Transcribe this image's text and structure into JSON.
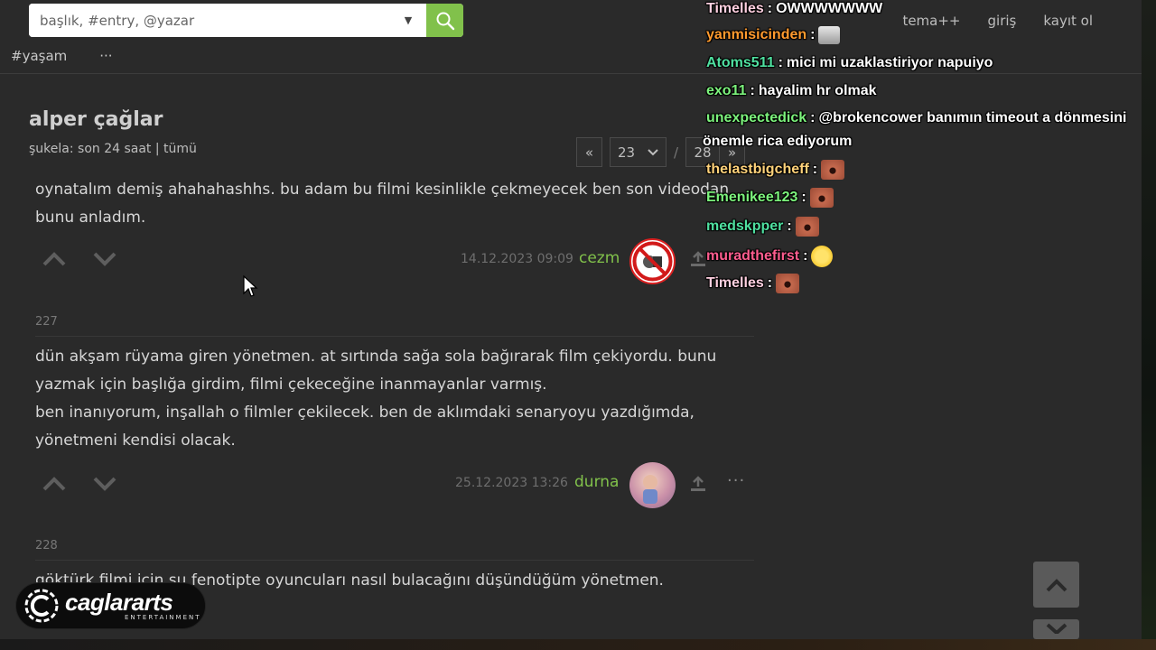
{
  "search": {
    "placeholder": "başlık, #entry, @yazar"
  },
  "top_nav": [
    "tema++",
    "giriş",
    "kayıt ol"
  ],
  "sub_nav": {
    "channel": "#yaşam",
    "more": "···"
  },
  "topic": {
    "title": "alper çağlar",
    "sukela_prefix": "şukela:",
    "sukela_links": [
      "son 24 saat",
      "tümü"
    ],
    "sep": "|"
  },
  "pager": {
    "prev": "«",
    "current": "23",
    "slash": "/",
    "total": "28",
    "next": "»"
  },
  "entries": [
    {
      "text_lines": [
        "oynatalım demiş ahahahashhs. bu adam bu filmi kesinlikle çekmeyecek ben son videodan",
        "bunu anladım."
      ],
      "date": "14.12.2023 09:09",
      "author": "cezm"
    },
    {
      "number": "227",
      "text_lines": [
        "dün akşam rüyama giren yönetmen. at sırtında sağa sola bağırarak film çekiyordu. bunu",
        "yazmak için başlığa girdim, filmi çekeceğine inanmayanlar varmış.",
        "ben inanıyorum, inşallah o filmler çekilecek. ben de aklımdaki senaryoyu yazdığımda,",
        "yönetmeni kendisi olacak."
      ],
      "date": "25.12.2023 13:26",
      "author": "durna",
      "more": "···"
    },
    {
      "number": "228",
      "text_lines": [
        "göktürk filmi için şu fenotipte oyuncuları nasıl bulacağını düşündüğüm yönetmen."
      ]
    }
  ],
  "chat": [
    {
      "user": "Timelles",
      "color": "#ffd0e0",
      "message": "OWWWWWWW"
    },
    {
      "user": "yanmisicinden",
      "color": "#ff9a2e",
      "message": "",
      "emote": "car"
    },
    {
      "user": "Atoms511",
      "color": "#4fe0a0",
      "message": "mici mi uzaklastiriyor napuiyo"
    },
    {
      "user": "exo11",
      "color": "#7cf27c",
      "message": "hayalim hr olmak"
    },
    {
      "user": "unexpectedick",
      "color": "#7cf27c",
      "message": "@brokencower banımın timeout a dönmesini",
      "message2": "önemle rica ediyorum"
    },
    {
      "user": "thelastbigcheff",
      "color": "#ffd27a",
      "message": "",
      "emote": "face"
    },
    {
      "user": "Emenikee123",
      "color": "#7cf27c",
      "message": "",
      "emote": "face"
    },
    {
      "user": "medskpper",
      "color": "#4fe0a0",
      "message": "",
      "emote": "face"
    },
    {
      "user": "muradthefirst",
      "color": "#ff5d8f",
      "message": "",
      "emote": "yellow"
    },
    {
      "user": "Timelles",
      "color": "#ffd0e0",
      "message": "",
      "emote": "face"
    }
  ],
  "chat_sep": ":",
  "watermark": {
    "brand": "caglararts",
    "tag": "ENTERTAINMENT"
  },
  "colors": {
    "accent_green": "#81c14b",
    "background": "#2a2a2a"
  }
}
